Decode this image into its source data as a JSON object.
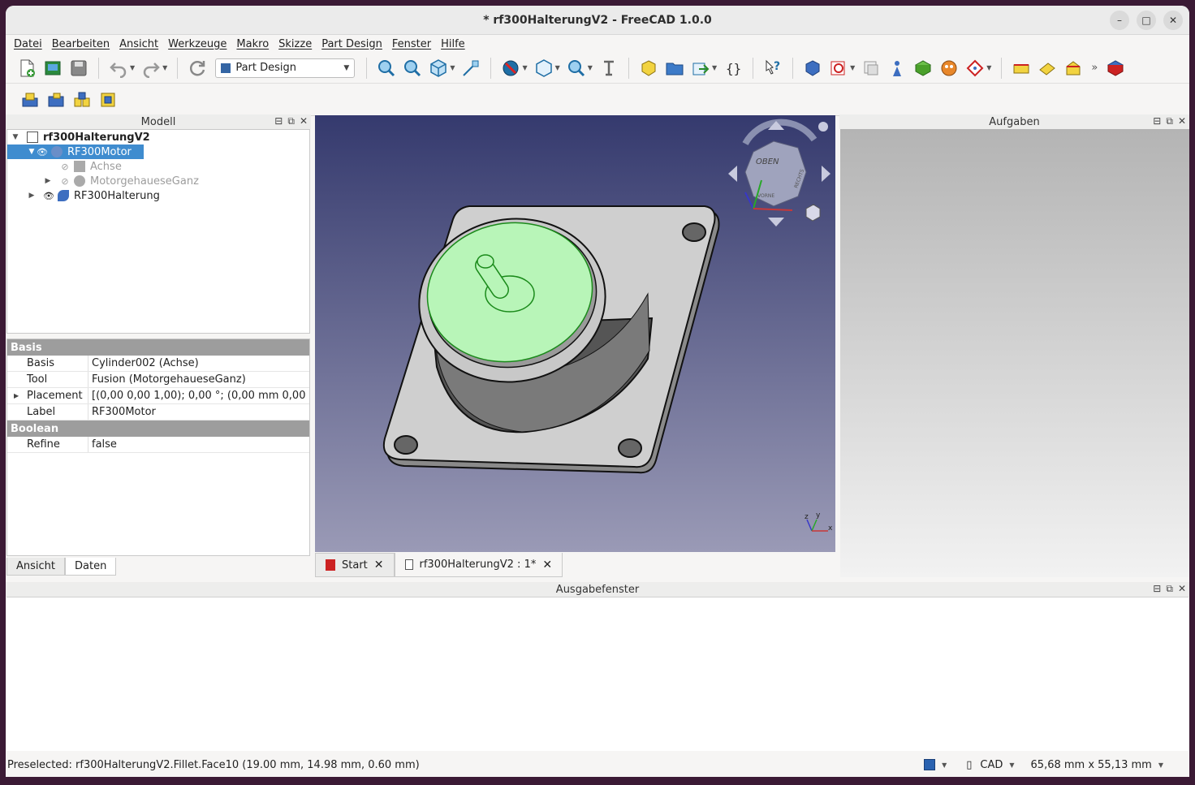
{
  "window": {
    "title": "* rf300HalterungV2 - FreeCAD 1.0.0"
  },
  "menu": [
    "Datei",
    "Bearbeiten",
    "Ansicht",
    "Werkzeuge",
    "Makro",
    "Skizze",
    "Part Design",
    "Fenster",
    "Hilfe"
  ],
  "toolbar": {
    "workbench": "Part Design",
    "overflow": "»"
  },
  "panels": {
    "model_title": "Modell",
    "tasks_title": "Aufgaben",
    "output_title": "Ausgabefenster"
  },
  "tree": {
    "root": "rf300HalterungV2",
    "items": [
      {
        "label": "RF300Motor",
        "selected": true
      },
      {
        "label": "Achse",
        "hidden": true
      },
      {
        "label": "MotorgehaueseGanz",
        "hidden": true
      },
      {
        "label": "RF300Halterung"
      }
    ]
  },
  "properties": {
    "group1": "Basis",
    "rows1": [
      {
        "key": "Basis",
        "value": "Cylinder002 (Achse)"
      },
      {
        "key": "Tool",
        "value": "Fusion (MotorgehaueseGanz)"
      },
      {
        "key": "Placement",
        "value": "[(0,00 0,00 1,00); 0,00 °; (0,00 mm  0,00 ..."
      },
      {
        "key": "Label",
        "value": "RF300Motor"
      }
    ],
    "group2": "Boolean",
    "rows2": [
      {
        "key": "Refine",
        "value": "false"
      }
    ]
  },
  "left_tabs": [
    "Ansicht",
    "Daten"
  ],
  "view_tabs": [
    "Start",
    "rf300HalterungV2 : 1*"
  ],
  "navcube": {
    "face_label": "OBEN",
    "front_label": "VORNE",
    "right_label": "RECHTS",
    "axis_z": "z",
    "axis_y": "y",
    "axis_x": "x"
  },
  "status": {
    "message": "Preselected: rf300HalterungV2.Fillet.Face10 (19.00 mm, 14.98 mm, 0.60 mm)",
    "nav_style": "CAD",
    "dimensions": "65,68 mm x 55,13 mm"
  },
  "colors": {
    "selection": "#3f8ccf",
    "face_highlight": "#b8f5b8",
    "view_top": "#353a6e",
    "view_bottom": "#9a9ab6"
  }
}
